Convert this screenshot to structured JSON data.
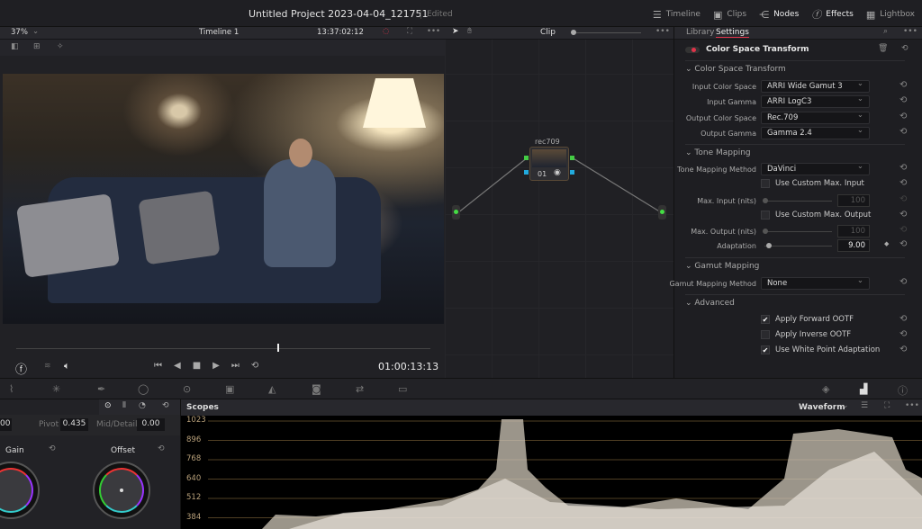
{
  "window": {
    "title": "Untitled Project 2023-04-04_121751",
    "status": "Edited"
  },
  "topnav": [
    {
      "icon": "timeline-icon",
      "label": "Timeline"
    },
    {
      "icon": "clips-icon",
      "label": "Clips"
    },
    {
      "icon": "nodes-icon",
      "label": "Nodes"
    },
    {
      "icon": "fx-icon",
      "label": "Effects"
    },
    {
      "icon": "lightbox-icon",
      "label": "Lightbox"
    }
  ],
  "viewer": {
    "zoom": "37%",
    "timeline": "Timeline 1",
    "source_timecode": "13:37:02:12",
    "timecode": "01:00:13:13",
    "playhead_fraction": 0.63
  },
  "nodes": {
    "mode": "Clip",
    "node_label": "rec709",
    "node_number": "01"
  },
  "inspector": {
    "tabs": [
      "Library",
      "Settings"
    ],
    "active_tab": "Settings",
    "effect": "Color Space Transform",
    "sections": {
      "cst": "Color Space Transform",
      "tone": "Tone Mapping",
      "gamut": "Gamut Mapping",
      "advanced": "Advanced"
    },
    "fields": {
      "input_cs": {
        "label": "Input Color Space",
        "value": "ARRI Wide Gamut 3"
      },
      "input_gamma": {
        "label": "Input Gamma",
        "value": "ARRI LogC3"
      },
      "output_cs": {
        "label": "Output Color Space",
        "value": "Rec.709"
      },
      "output_gamma": {
        "label": "Output Gamma",
        "value": "Gamma 2.4"
      },
      "tone_method": {
        "label": "Tone Mapping Method",
        "value": "DaVinci"
      },
      "custom_in": {
        "label": "Use Custom Max. Input",
        "checked": false
      },
      "max_in": {
        "label": "Max. Input (nits)",
        "value": "100"
      },
      "custom_out": {
        "label": "Use Custom Max. Output",
        "checked": false
      },
      "max_out": {
        "label": "Max. Output (nits)",
        "value": "100"
      },
      "adaptation": {
        "label": "Adaptation",
        "value": "9.00"
      },
      "gamut_method": {
        "label": "Gamut Mapping Method",
        "value": "None"
      },
      "fwd_ootf": {
        "label": "Apply Forward OOTF",
        "checked": true
      },
      "inv_ootf": {
        "label": "Apply Inverse OOTF",
        "checked": false
      },
      "wpa": {
        "label": "Use White Point Adaptation",
        "checked": true
      }
    }
  },
  "color": {
    "partial_value": "00",
    "pivot_label": "Pivot",
    "pivot": "0.435",
    "md_label": "Mid/Detail",
    "md": "0.00",
    "gain": "Gain",
    "offset": "Offset"
  },
  "scopes": {
    "title": "Scopes",
    "mode": "Waveform",
    "ticks": [
      "1023",
      "896",
      "768",
      "640",
      "512",
      "384"
    ]
  },
  "colors": {
    "accent": "#e0334a",
    "graticule": "#6b5530"
  }
}
